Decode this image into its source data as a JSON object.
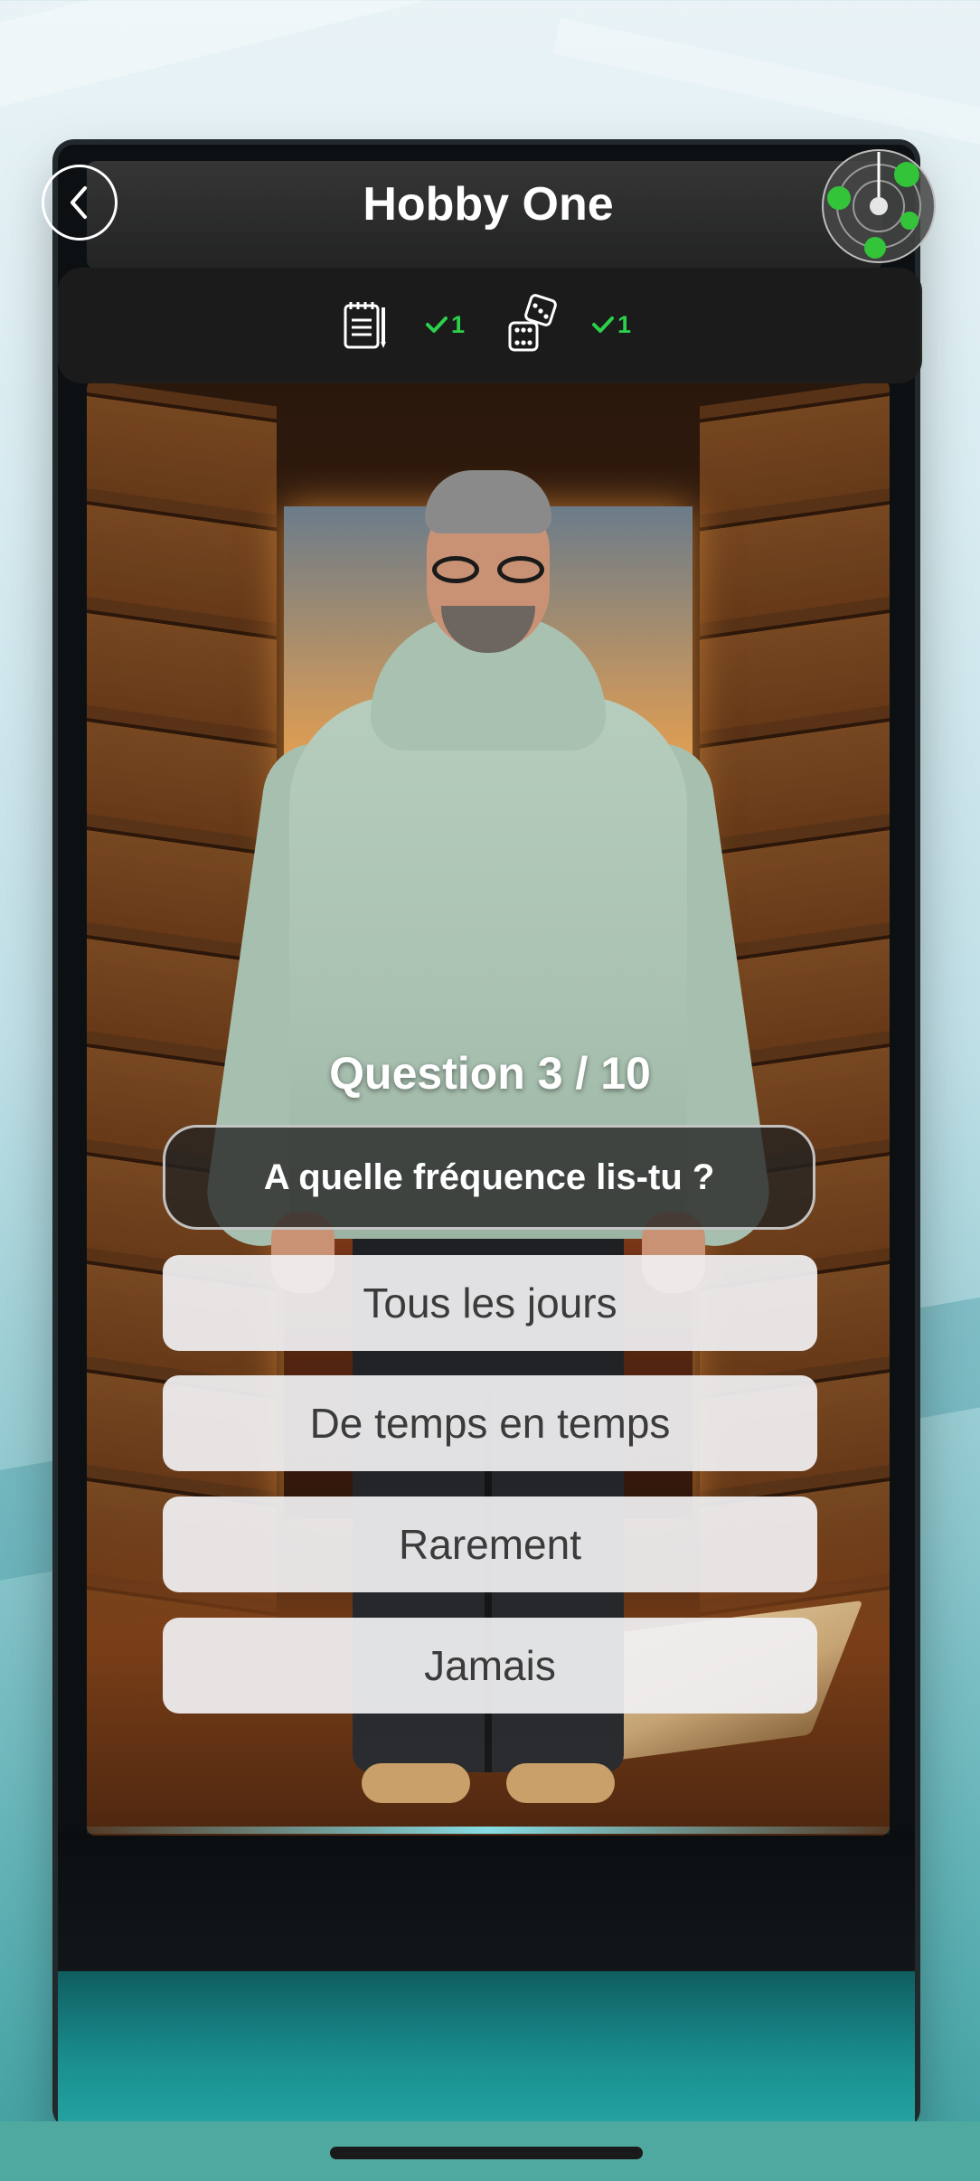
{
  "header": {
    "title": "Hobby One",
    "back_icon": "chevron-left-icon",
    "radar_icon": "radar-icon"
  },
  "stats": [
    {
      "icon": "notepad-icon",
      "value": "1",
      "status_icon": "check-icon"
    },
    {
      "icon": "dice-icon",
      "value": "1",
      "status_icon": "check-icon"
    }
  ],
  "quiz": {
    "counter": "Question 3 / 10",
    "question": "A quelle fréquence lis-tu ?",
    "answers": [
      "Tous les jours",
      "De temps en temps",
      "Rarement",
      "Jamais"
    ]
  },
  "colors": {
    "check_green": "#2bd14b",
    "radar_green": "#33c43a",
    "answer_bg": "#f0f0f2",
    "accent_teal": "#4fa9a0"
  }
}
